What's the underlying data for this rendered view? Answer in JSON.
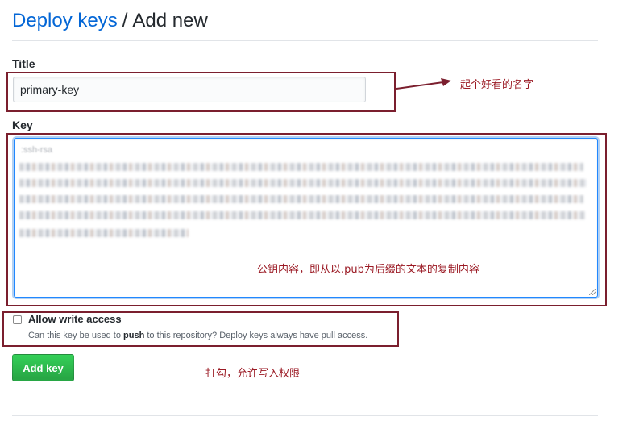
{
  "header": {
    "parent_link": "Deploy keys",
    "separator": "/",
    "current": "Add new"
  },
  "title_field": {
    "label": "Title",
    "value": "primary-key"
  },
  "key_field": {
    "label": "Key",
    "first_line": ":ssh-rsa"
  },
  "write_access": {
    "label": "Allow write access",
    "note_before": "Can this key be used to ",
    "note_bold": "push",
    "note_after": " to this repository? Deploy keys always have pull access.",
    "checked": false
  },
  "submit": {
    "label": "Add key"
  },
  "annotations": {
    "title_hint": "起个好看的名字",
    "key_hint": "公钥内容，即从以.pub为后缀的文本的复制内容",
    "checkbox_hint": "打勾，允许写入权限",
    "color": "#9b1a24"
  },
  "colors": {
    "link": "#0366d6",
    "button": "#28a745",
    "annotation_border": "#7b1f2e"
  }
}
